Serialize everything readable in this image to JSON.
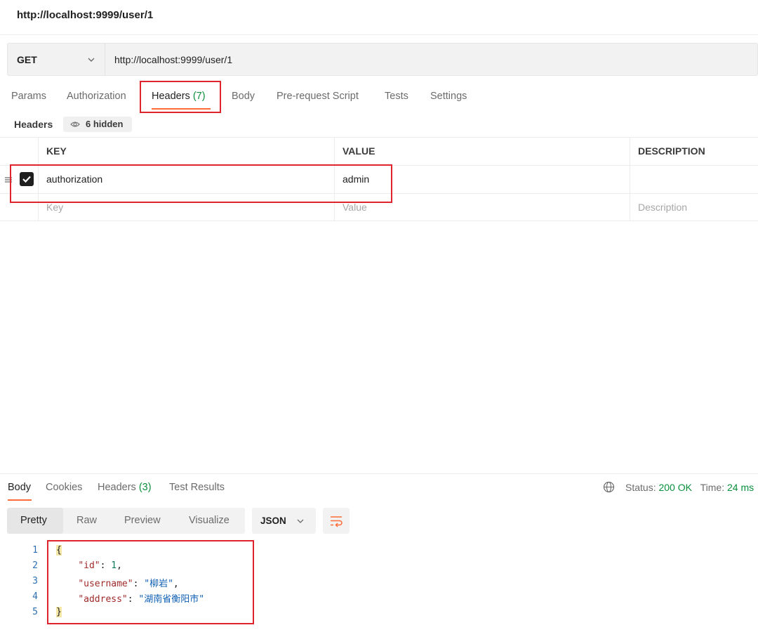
{
  "window": {
    "title": "http://localhost:9999/user/1"
  },
  "request": {
    "method": "GET",
    "url": "http://localhost:9999/user/1"
  },
  "request_tabs": [
    {
      "label": "Params"
    },
    {
      "label": "Authorization"
    },
    {
      "label": "Headers ",
      "count": "(7)",
      "active": true
    },
    {
      "label": "Body"
    },
    {
      "label": "Pre-request Script"
    },
    {
      "label": "Tests"
    },
    {
      "label": "Settings"
    }
  ],
  "headers_section": {
    "label": "Headers",
    "hidden_label": "6 hidden"
  },
  "headers_table": {
    "columns": [
      "KEY",
      "VALUE",
      "DESCRIPTION"
    ],
    "rows": [
      {
        "checked": true,
        "key": "authorization",
        "value": "admin",
        "description": ""
      }
    ],
    "placeholder": {
      "key": "Key",
      "value": "Value",
      "description": "Description"
    }
  },
  "response_tabs": [
    {
      "label": "Body",
      "active": true
    },
    {
      "label": "Cookies"
    },
    {
      "label": "Headers ",
      "count": "(3)"
    },
    {
      "label": "Test Results"
    }
  ],
  "response_status": {
    "status_label": "Status: ",
    "status_value": "200 OK",
    "time_label": "Time: ",
    "time_value": "24 ms"
  },
  "view_modes": [
    "Pretty",
    "Raw",
    "Preview",
    "Visualize"
  ],
  "active_view_mode": "Pretty",
  "format": "JSON",
  "response_body": {
    "line_numbers": [
      "1",
      "2",
      "3",
      "4",
      "5"
    ],
    "open_brace": "{",
    "close_brace": "}",
    "fields": [
      {
        "key": "\"id\"",
        "sep": ": ",
        "value": "1",
        "trail": ",",
        "type": "number"
      },
      {
        "key": "\"username\"",
        "sep": ": ",
        "value": "\"柳岩\"",
        "trail": ",",
        "type": "string"
      },
      {
        "key": "\"address\"",
        "sep": ": ",
        "value": "\"湖南省衡阳市\"",
        "trail": "",
        "type": "string"
      }
    ]
  },
  "colors": {
    "accent": "#ff6c37",
    "highlight": "#e0242e",
    "success": "#0a8f3c"
  },
  "icons": [
    "chevron-down-icon",
    "eye-icon",
    "drag-handle-icon",
    "checkbox-checked-icon",
    "globe-icon",
    "wrap-lines-icon"
  ]
}
